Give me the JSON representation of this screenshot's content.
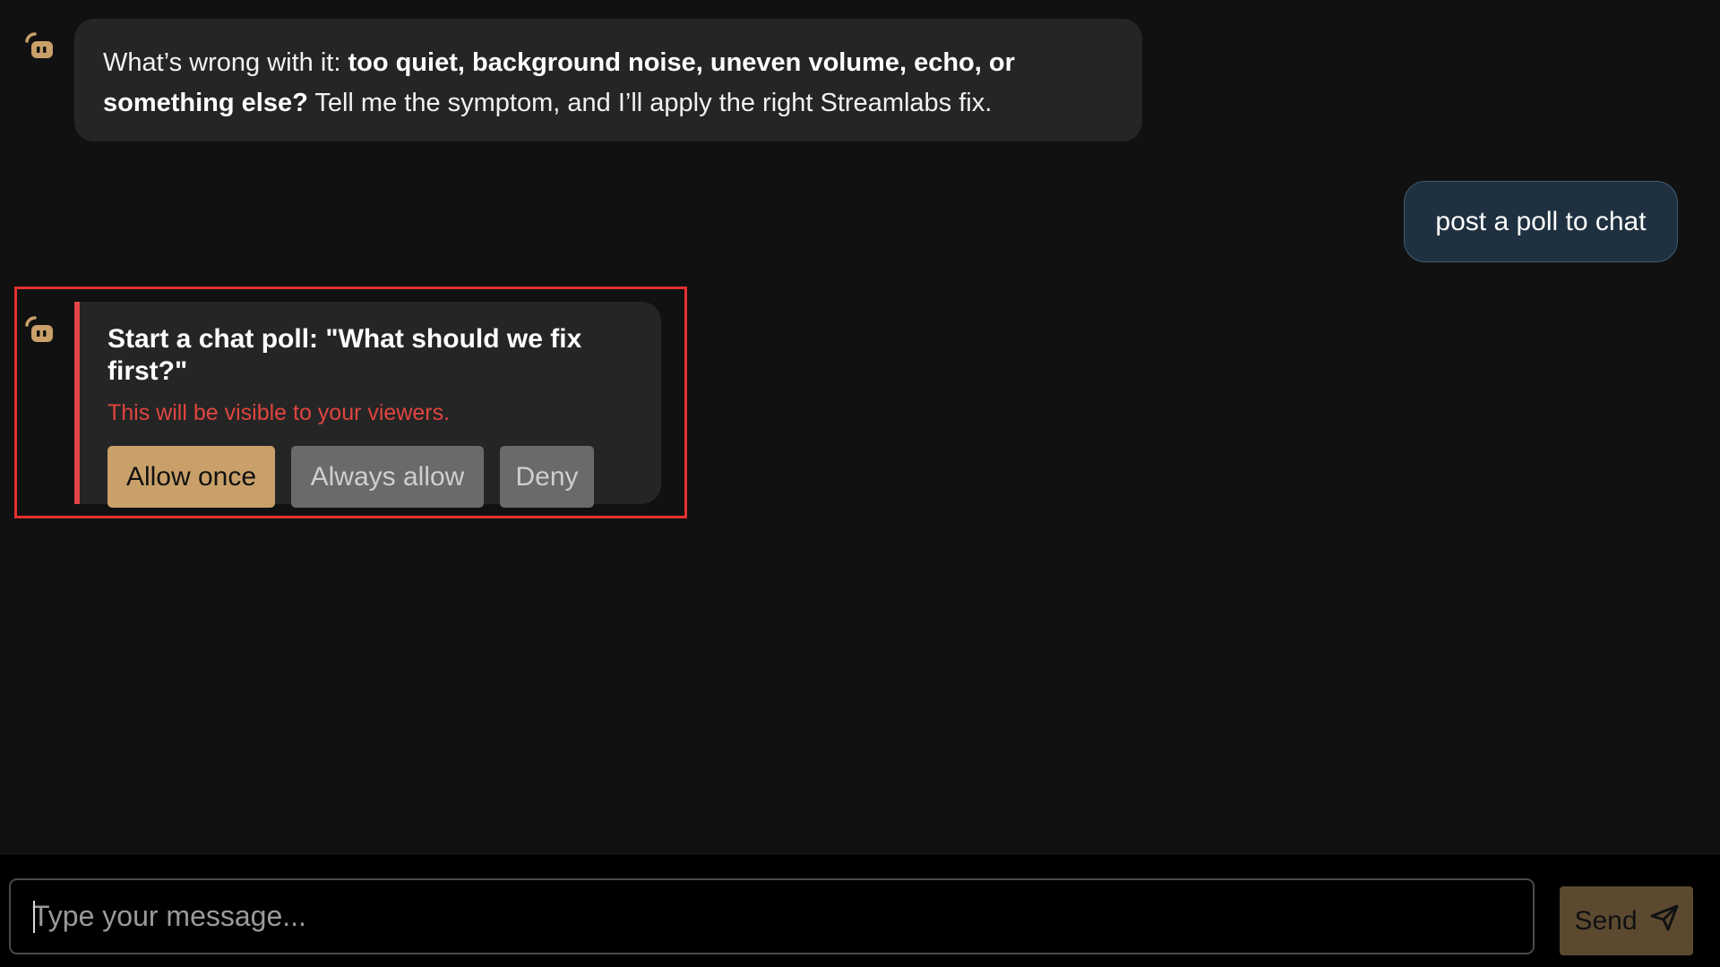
{
  "colors": {
    "background": "#111111",
    "bot_bubble": "#252525",
    "user_bubble": "#1f3140",
    "accent_gold": "#c9a06a",
    "warning_red": "#e0453f",
    "highlight_red": "#e53030",
    "send_button": "#5c4a30"
  },
  "messages": [
    {
      "role": "bot",
      "avatar_icon": "streamlabs-bot-icon",
      "text_parts": [
        {
          "text": "What’s wrong with it: ",
          "bold": false
        },
        {
          "text": "too quiet, background noise, uneven volume, echo, or something else?",
          "bold": true
        },
        {
          "text": " Tell me the symptom, and I’ll apply the right Streamlabs fix.",
          "bold": false
        }
      ]
    },
    {
      "role": "user",
      "text": "post a poll to chat"
    }
  ],
  "permission_request": {
    "avatar_icon": "streamlabs-bot-icon",
    "title": "Start a chat poll: \"What should we fix first?\"",
    "warning": "This will be visible to your viewers.",
    "buttons": {
      "allow_once": "Allow once",
      "always_allow": "Always allow",
      "deny": "Deny"
    }
  },
  "composer": {
    "placeholder": "Type your message...",
    "value": "",
    "send_label": "Send",
    "send_icon": "paper-plane-icon"
  }
}
